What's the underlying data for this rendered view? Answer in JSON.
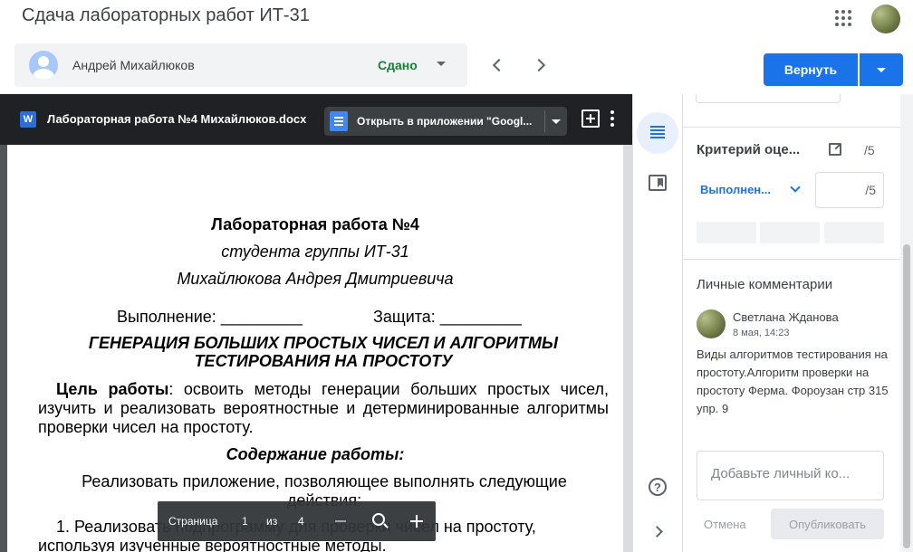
{
  "app": {
    "title": "Сдача лабораторных работ ИТ-31"
  },
  "header": {
    "apps_icon": "apps-grid-icon",
    "avatar_icon": "user-avatar"
  },
  "student": {
    "name": "Андрей Михайлюков",
    "status": "Сдано",
    "status_color": "#188038"
  },
  "actions": {
    "return_label": "Вернуть",
    "accent": "#1a73e8"
  },
  "viewer": {
    "file_name": "Лабораторная работа №4 Михайлюков.docx",
    "open_in_app": "Открыть в приложении \"Googl...",
    "file_icon": "W"
  },
  "document": {
    "title": "Лабораторная работа №4",
    "subtitle1": "студента группы ИТ-31",
    "subtitle2": "Михайлюкова Андрея Дмитриевича",
    "execution": "Выполнение: _________",
    "defense": "Защита: _________",
    "heading": "ГЕНЕРАЦИЯ БОЛЬШИХ ПРОСТЫХ ЧИСЕЛ И АЛГОРИТМЫ ТЕСТИРОВАНИЯ НА ПРОСТОТУ",
    "goal_label": "Цель работы",
    "goal_text": ": освоить методы генерации больших простых чисел, изучить и реализовать вероятностные и детерминированные алгоритмы проверки чисел на простоту.",
    "content_heading": "Содержание работы:",
    "content_text": "Реализовать приложение, позволяющее выполнять следующие действия:",
    "item1": "1. Реализовать подпрограмму для проверки чисел на простоту, используя изученные вероятностные методы."
  },
  "pager": {
    "label": "Страница",
    "current": "1",
    "of": "из",
    "total": "4"
  },
  "rubric": {
    "criterion_title": "Критерий оце...",
    "max": "/5",
    "level": "Выполнен...",
    "score_max": "/5"
  },
  "comments": {
    "title": "Личные комментарии",
    "author": "Светлана Жданова",
    "time": "8 мая, 14:23",
    "text": "Виды алгоритмов тестирования на простоту.Алгоритм проверки на простоту Ферма. Фороузан стр 315 упр. 9",
    "input_placeholder": "Добавьте личный ко...",
    "cancel": "Отмена",
    "publish": "Опубликовать"
  },
  "rail": {
    "help": "?"
  }
}
